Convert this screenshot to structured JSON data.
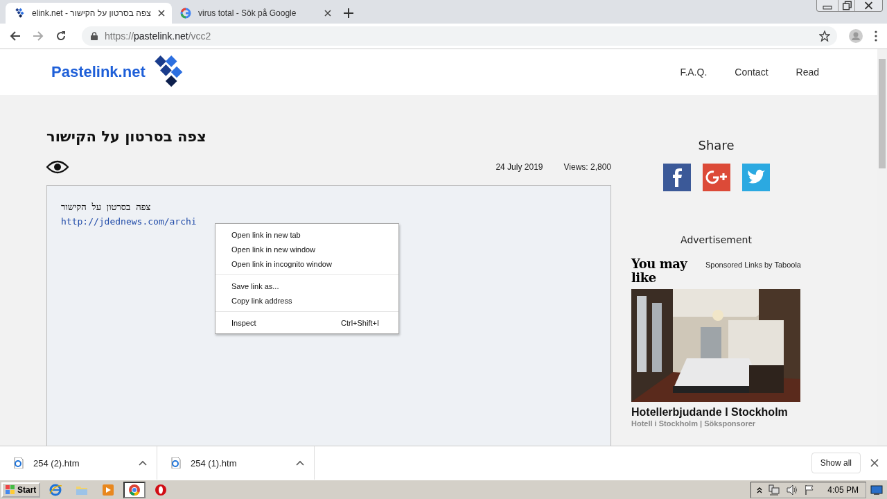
{
  "browser": {
    "tabs": [
      {
        "title": "צפה בסרטון על הקישור - elink.net",
        "kind": "pastelink",
        "selected": true
      },
      {
        "title": "virus total - Sök på Google",
        "kind": "google",
        "selected": false
      }
    ],
    "url": {
      "scheme": "https://",
      "host": "pastelink.net",
      "path": "/vcc2"
    }
  },
  "site": {
    "logo": "Pastelink.net",
    "nav": [
      "F.A.Q.",
      "Contact",
      "Read"
    ]
  },
  "paste": {
    "title": "צפה בסרטון על הקישור",
    "date": "24 July 2019",
    "views": "Views: 2,800",
    "lines": [
      {
        "kind": "text",
        "text": "צפה בסרטון על הקישור"
      },
      {
        "kind": "link",
        "text": "http://jdednews.com/archi"
      }
    ]
  },
  "sidebar": {
    "share_heading": "Share",
    "social": [
      {
        "kind": "facebook"
      },
      {
        "kind": "googleplus"
      },
      {
        "kind": "twitter"
      }
    ],
    "ad_label": "Advertisement",
    "widget": {
      "heading": "You may like",
      "sponsor": "Sponsored Links by Taboola",
      "item": {
        "kind": "picture",
        "title": "Hotellerbjudande I Stockholm",
        "source": "Hotell i Stockholm | Söksponsorer"
      }
    }
  },
  "context_menu": {
    "groups": [
      [
        {
          "label": "Open link in new tab"
        },
        {
          "label": "Open link in new window"
        },
        {
          "label": "Open link in incognito window"
        }
      ],
      [
        {
          "label": "Save link as..."
        },
        {
          "label": "Copy link address"
        }
      ],
      [
        {
          "label": "Inspect",
          "shortcut": "Ctrl+Shift+I"
        }
      ]
    ]
  },
  "downloads": {
    "items": [
      {
        "name": "254 (2).htm"
      },
      {
        "name": "254 (1).htm"
      }
    ],
    "show_all": "Show all"
  },
  "taskbar": {
    "start": "Start",
    "apps": [
      {
        "kind": "ie",
        "selected": false
      },
      {
        "kind": "folder",
        "selected": false
      },
      {
        "kind": "media",
        "selected": false
      },
      {
        "kind": "chrome",
        "selected": true
      },
      {
        "kind": "opera",
        "selected": false
      }
    ],
    "clock": "4:05 PM"
  }
}
